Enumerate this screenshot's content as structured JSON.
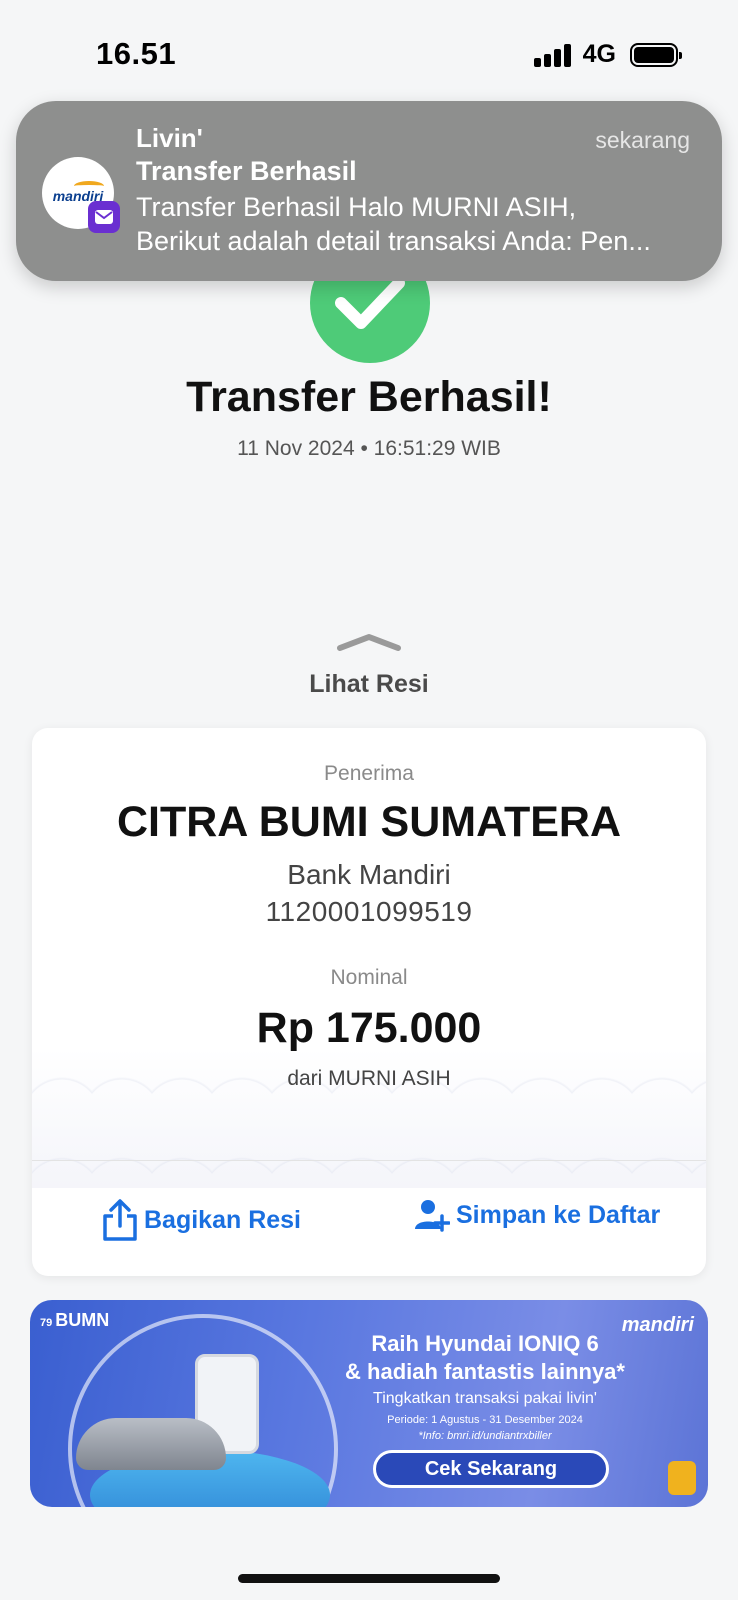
{
  "status_bar": {
    "time": "16.51",
    "network": "4G"
  },
  "notification": {
    "app": "Livin'",
    "time": "sekarang",
    "title": "Transfer Berhasil",
    "body_line1": "Transfer Berhasil Halo MURNI ASIH,",
    "body_line2": "Berikut adalah detail transaksi Anda: Pen...",
    "icon_brand": "mandiri",
    "badge": "yahoo!"
  },
  "success": {
    "title": "Transfer Berhasil!",
    "datetime": "11 Nov 2024 • 16:51:29 WIB"
  },
  "receipt": {
    "toggle_label": "Lihat Resi",
    "recipient_label": "Penerima",
    "recipient_name": "CITRA BUMI SUMATERA",
    "bank": "Bank Mandiri",
    "account_number": "1120001099519",
    "amount_label": "Nominal",
    "amount": "Rp 175.000",
    "from": "dari MURNI ASIH",
    "share_label": "Bagikan Resi",
    "save_label": "Simpan ke Daftar"
  },
  "banner": {
    "logo_bumn": "BUMN",
    "logo_mandiri": "mandiri",
    "title_line1": "Raih Hyundai IONIQ 6",
    "title_line2": "& hadiah fantastis lainnya*",
    "subtitle": "Tingkatkan transaksi pakai livin'",
    "period": "Periode: 1 Agustus - 31 Desember 2024",
    "info": "*Info: bmri.id/undiantrxbiller",
    "button": "Cek Sekarang"
  },
  "colors": {
    "accent": "#1a6fe0",
    "success": "#4ecb78",
    "notification_bg": "#8e8f8e"
  }
}
